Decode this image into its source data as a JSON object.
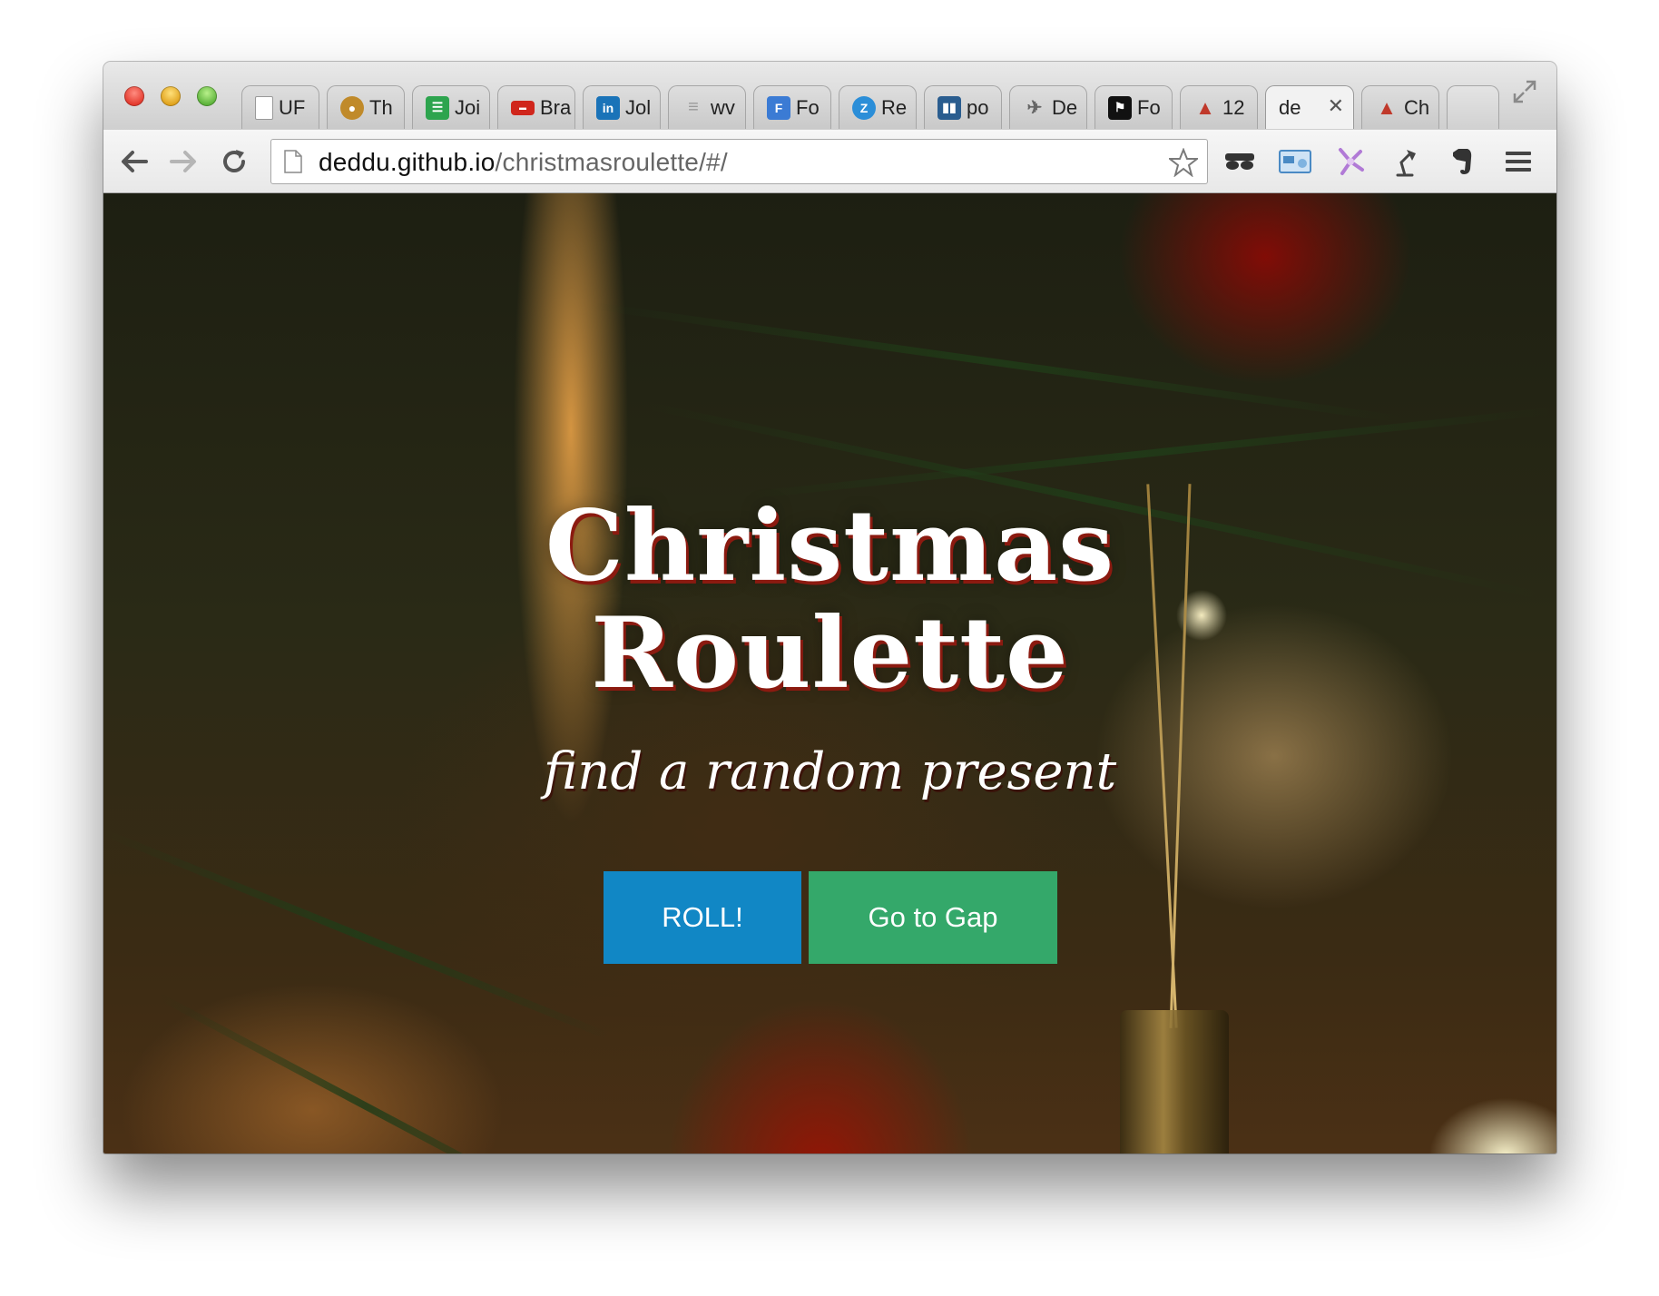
{
  "browser": {
    "tabs": [
      {
        "label": "UF",
        "icon": "document-icon",
        "color": "#ffffff"
      },
      {
        "label": "Th",
        "icon": "monkey-icon",
        "color": "#c08a2a"
      },
      {
        "label": "Joi",
        "icon": "spreadsheet-icon",
        "color": "#2da44e"
      },
      {
        "label": "Bra",
        "icon": "brand-icon",
        "color": "#d0261c"
      },
      {
        "label": "Jol",
        "icon": "linkedin-icon",
        "color": "#1a73b8"
      },
      {
        "label": "wv",
        "icon": "text-icon",
        "color": "#9a9a9a"
      },
      {
        "label": "Fo",
        "icon": "f-icon",
        "color": "#3b7bd4"
      },
      {
        "label": "Re",
        "icon": "z-icon",
        "color": "#2b8ed8"
      },
      {
        "label": "po",
        "icon": "trello-icon",
        "color": "#2a5d8f"
      },
      {
        "label": "De",
        "icon": "bird-icon",
        "color": "#777777"
      },
      {
        "label": "Fo",
        "icon": "flag-icon",
        "color": "#111111"
      },
      {
        "label": "12",
        "icon": "hat-icon",
        "color": "#c0392b"
      },
      {
        "label": "de",
        "icon": "",
        "color": "#f2f2f2",
        "active": true
      },
      {
        "label": "Ch",
        "icon": "hat-icon",
        "color": "#c0392b"
      }
    ],
    "active_tab_close": "✕",
    "url_host": "deddu.github.io",
    "url_path": "/christmasroulette/#/"
  },
  "page": {
    "title_line1": "Christmas",
    "title_line2": "Roulette",
    "subtitle": "find a random present",
    "roll_button": "ROLL!",
    "gap_button": "Go to Gap",
    "roll_color": "#1187c5",
    "gap_color": "#34a86a"
  }
}
